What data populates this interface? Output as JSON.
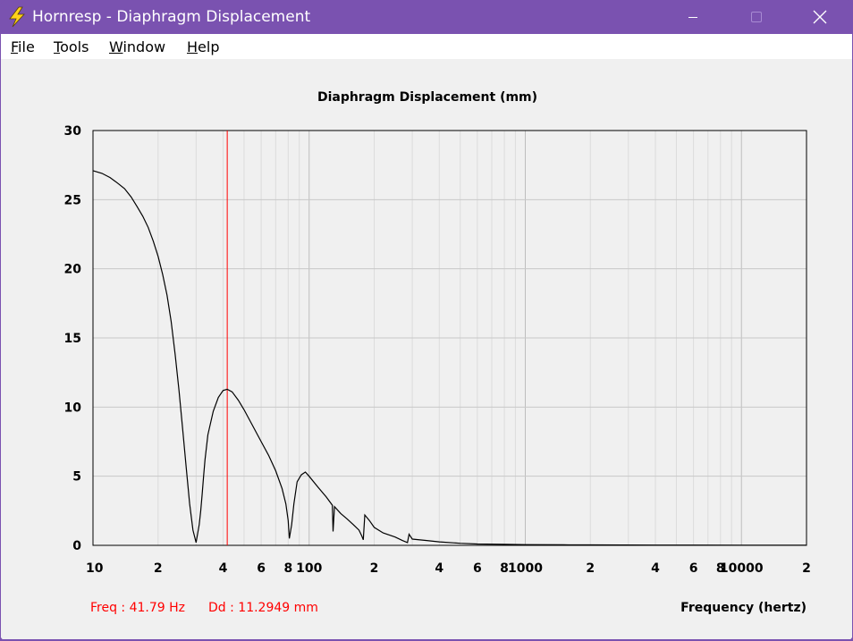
{
  "window": {
    "title": "Hornresp - Diaphragm Displacement",
    "icon": "lightning-bolt-icon",
    "controls": [
      "minimize-icon",
      "maximize-icon",
      "close-icon"
    ]
  },
  "menu": {
    "items": [
      {
        "label": "File",
        "mnemonic": "F",
        "rest": "ile"
      },
      {
        "label": "Tools",
        "mnemonic": "T",
        "rest": "ools"
      },
      {
        "label": "Window",
        "mnemonic": "W",
        "rest": "indow"
      },
      {
        "label": "Help",
        "mnemonic": "H",
        "rest": "elp"
      }
    ]
  },
  "status": {
    "freq": "Freq : 41.79 Hz",
    "dd": "Dd : 11.2949 mm",
    "color": "#ff0000"
  },
  "chart_data": {
    "type": "line",
    "title": "Diaphragm Displacement (mm)",
    "xlabel": "Frequency (hertz)",
    "ylabel": "",
    "xscale": "log",
    "xlim": [
      10,
      20000
    ],
    "ylim": [
      0,
      30
    ],
    "grid": true,
    "yticks": [
      0,
      5,
      10,
      15,
      20,
      25,
      30
    ],
    "ytick_labels": [
      "0",
      "5",
      "10",
      "15",
      "20",
      "25",
      "30"
    ],
    "xticks": [
      10,
      20,
      40,
      60,
      80,
      100,
      200,
      400,
      600,
      800,
      1000,
      2000,
      4000,
      6000,
      8000,
      10000,
      20000
    ],
    "xtick_labels": [
      "10",
      "2",
      "4",
      "6",
      "8",
      "100",
      "2",
      "4",
      "6",
      "8",
      "1000",
      "2",
      "4",
      "6",
      "8",
      "10000",
      "2"
    ],
    "cursor": {
      "x": 41.79,
      "color": "#ff0000"
    },
    "series": [
      {
        "color": "#000000",
        "x": [
          10,
          11,
          12,
          13,
          14,
          15,
          16,
          17,
          18,
          19,
          20,
          21,
          22,
          23,
          24,
          25,
          26,
          27,
          28,
          29,
          30,
          31,
          31.5,
          32,
          32.5,
          33,
          34,
          36,
          38,
          40,
          41.79,
          44,
          47,
          50,
          55,
          60,
          65,
          70,
          75,
          78,
          80,
          81,
          83,
          85,
          88,
          92,
          96,
          100,
          110,
          120,
          128,
          129,
          131,
          140,
          150,
          160,
          170,
          175,
          178,
          181,
          190,
          200,
          220,
          250,
          270,
          285,
          290,
          300,
          350,
          400,
          500,
          600,
          800,
          1000,
          1500,
          2000,
          4000,
          6000,
          10000,
          20000
        ],
        "values": [
          27.1,
          26.9,
          26.6,
          26.2,
          25.8,
          25.2,
          24.5,
          23.8,
          23.0,
          22.0,
          20.9,
          19.6,
          18.1,
          16.2,
          13.8,
          11.2,
          8.4,
          5.6,
          3.0,
          1.1,
          0.2,
          1.5,
          2.5,
          3.7,
          5.0,
          6.2,
          8.0,
          9.7,
          10.7,
          11.2,
          11.29,
          11.1,
          10.5,
          9.8,
          8.6,
          7.5,
          6.5,
          5.4,
          4.1,
          3.0,
          1.8,
          0.5,
          1.5,
          3.0,
          4.6,
          5.1,
          5.3,
          5.0,
          4.2,
          3.5,
          2.9,
          1.0,
          2.8,
          2.3,
          1.9,
          1.5,
          1.1,
          0.7,
          0.4,
          2.2,
          1.8,
          1.3,
          0.9,
          0.6,
          0.35,
          0.2,
          0.8,
          0.45,
          0.35,
          0.25,
          0.15,
          0.1,
          0.07,
          0.05,
          0.04,
          0.03,
          0.02,
          0.02,
          0.01,
          0.01
        ]
      }
    ]
  }
}
